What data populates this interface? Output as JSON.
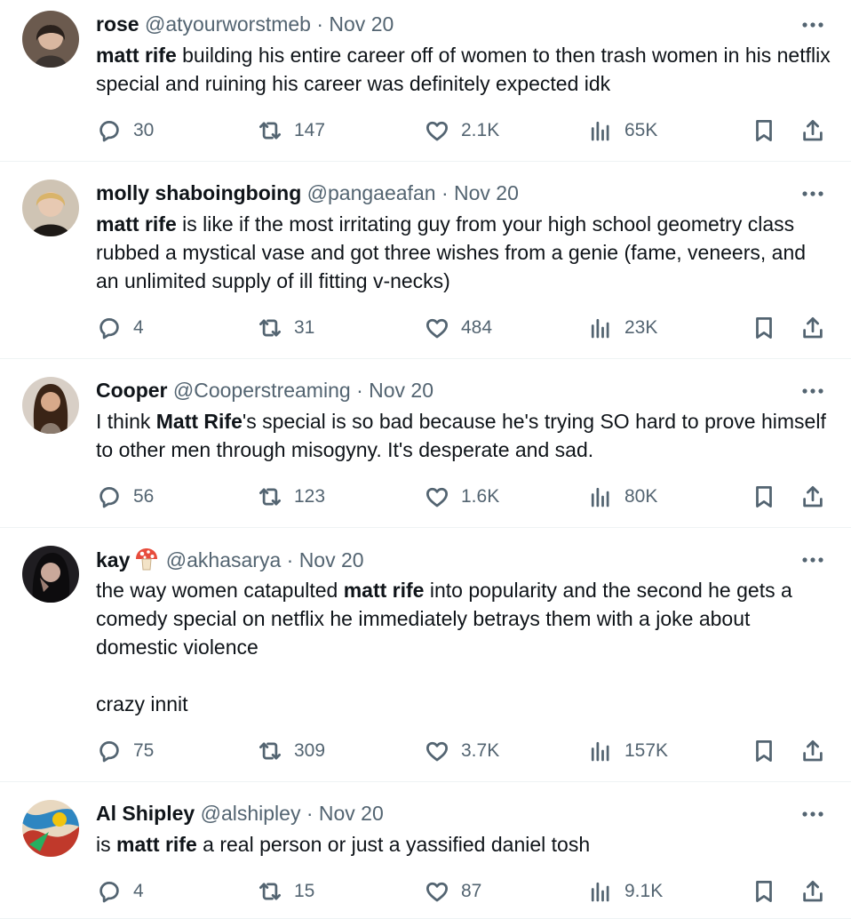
{
  "tweets": [
    {
      "name": "rose",
      "handle": "@atyourworstmeb",
      "date": "Nov 20",
      "text_html": "<b>matt rife</b> building his entire career off of women to then trash women in his netflix special and ruining his career was definitely expected idk",
      "replies": "30",
      "retweets": "147",
      "likes": "2.1K",
      "views": "65K"
    },
    {
      "name": "molly shaboingboing",
      "handle": "@pangaeafan",
      "date": "Nov 20",
      "text_html": "<b>matt rife</b> is like if the most irritating guy from your high school geometry class rubbed a mystical vase and got three wishes from a genie (fame, veneers, and an unlimited supply of ill fitting v-necks)",
      "replies": "4",
      "retweets": "31",
      "likes": "484",
      "views": "23K"
    },
    {
      "name": "Cooper",
      "handle": "@Cooperstreaming",
      "date": "Nov 20",
      "text_html": "I think <b>Matt Rife</b>'s special is so bad because he's trying SO hard to prove himself to other men through misogyny. It's desperate and sad.",
      "replies": "56",
      "retweets": "123",
      "likes": "1.6K",
      "views": "80K"
    },
    {
      "name": "kay",
      "name_emoji": "mushroom-emoji",
      "handle": "@akhasarya",
      "date": "Nov 20",
      "text_html": "the way women catapulted <b>matt rife</b> into popularity and the second he gets a comedy special on netflix he immediately betrays them with a joke about domestic violence<br><br>crazy innit",
      "replies": "75",
      "retweets": "309",
      "likes": "3.7K",
      "views": "157K"
    },
    {
      "name": "Al Shipley",
      "handle": "@alshipley",
      "date": "Nov 20",
      "text_html": "is <b>matt rife</b> a real person or just a yassified daniel tosh",
      "replies": "4",
      "retweets": "15",
      "likes": "87",
      "views": "9.1K"
    }
  ],
  "separator": "·",
  "icons": {
    "reply": "speech-bubble-icon",
    "retweet": "retweet-arrows-icon",
    "like": "heart-icon",
    "views": "bar-chart-icon",
    "bookmark": "bookmark-icon",
    "share": "share-upload-icon",
    "more": "more-dots-icon"
  },
  "colors": {
    "text": "#0f1419",
    "muted": "#536471",
    "divider": "#eff3f4"
  }
}
